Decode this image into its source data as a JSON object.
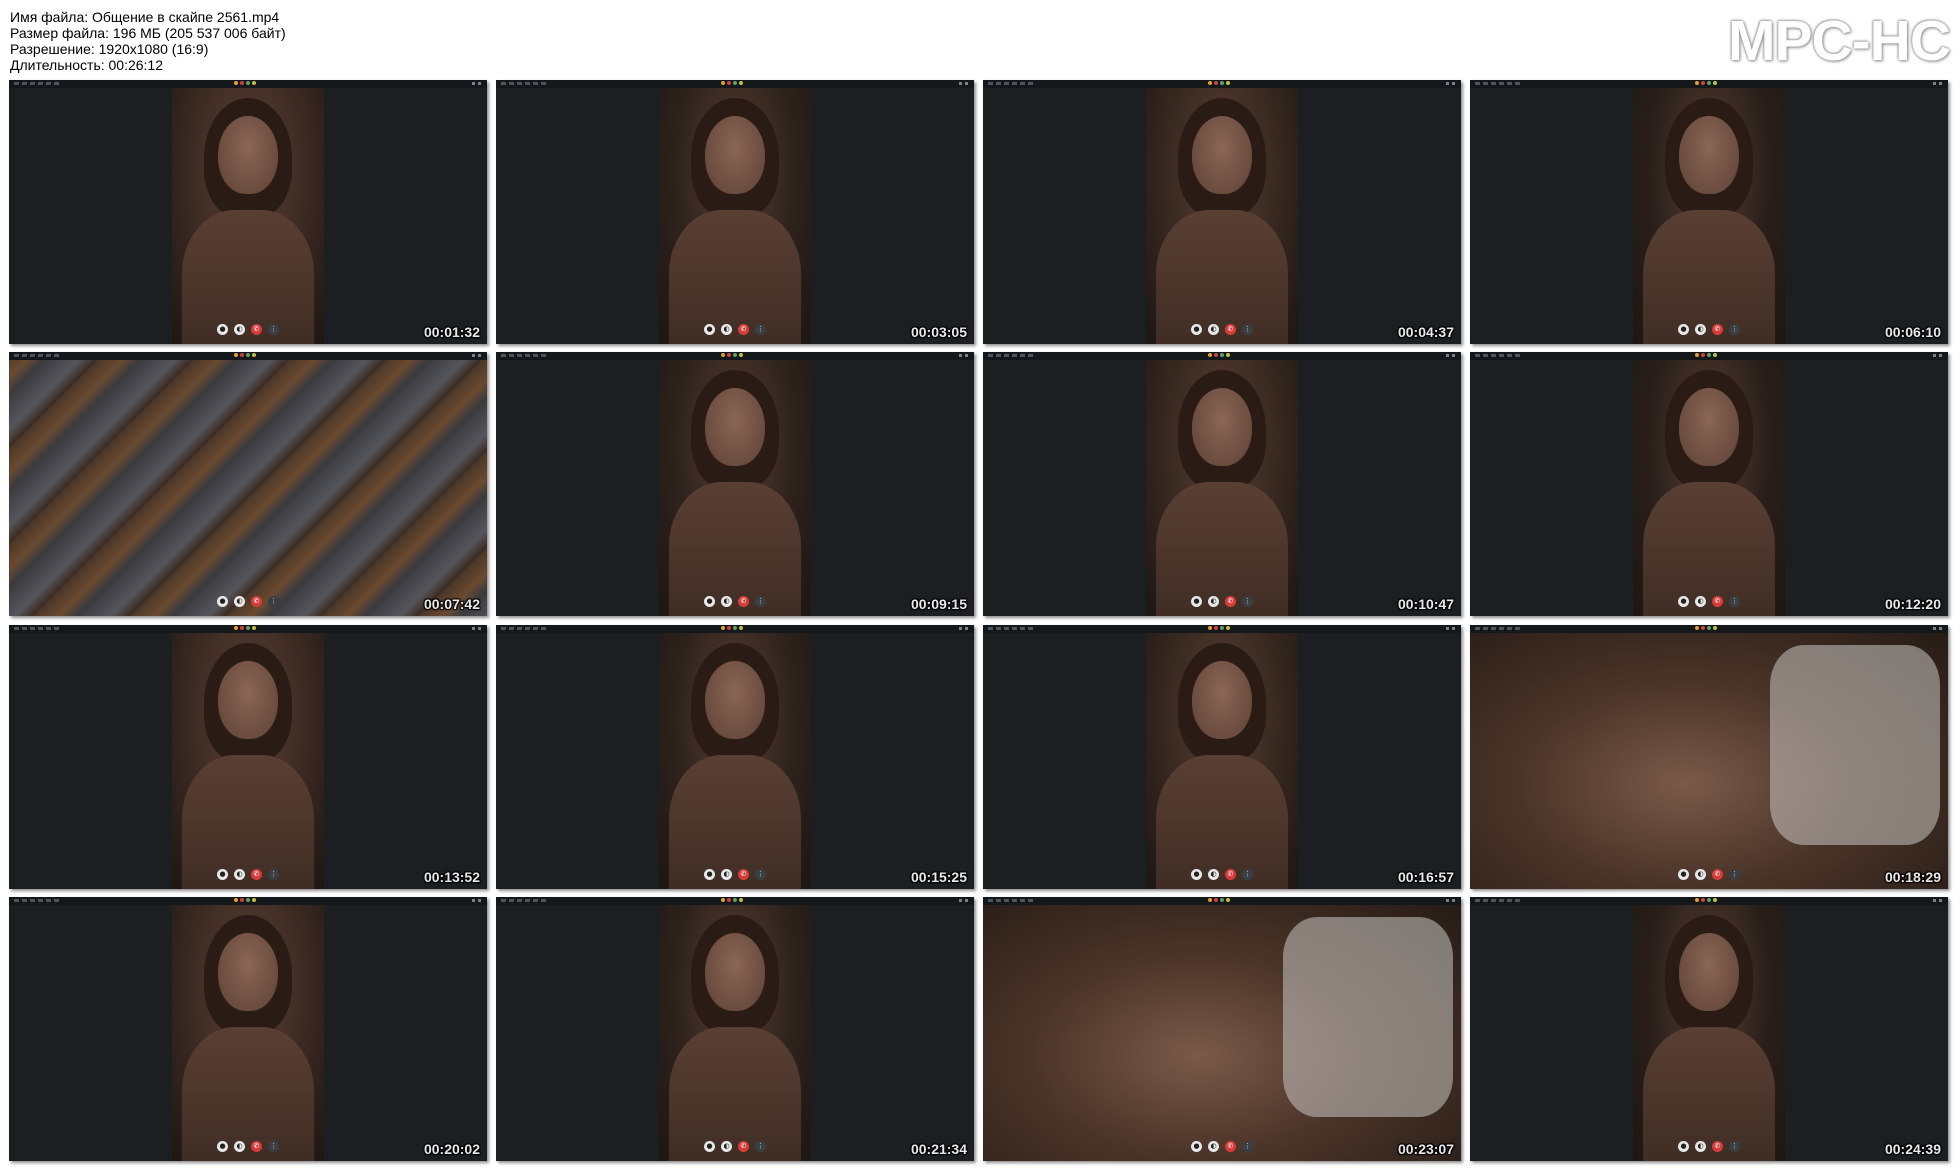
{
  "info": {
    "file_name": "Имя файла: Общение в скайпе 2561.mp4",
    "file_size": "Размер файла: 196 МБ (205 537 006 байт)",
    "resolution": "Разрешение: 1920x1080 (16:9)",
    "duration": "Длительность: 00:26:12"
  },
  "logo": "MPC-HC",
  "thumbnails": [
    {
      "time": "00:01:32",
      "scene": "portrait"
    },
    {
      "time": "00:03:05",
      "scene": "portrait"
    },
    {
      "time": "00:04:37",
      "scene": "portrait"
    },
    {
      "time": "00:06:10",
      "scene": "portrait"
    },
    {
      "time": "00:07:42",
      "scene": "ceiling"
    },
    {
      "time": "00:09:15",
      "scene": "portrait"
    },
    {
      "time": "00:10:47",
      "scene": "portrait"
    },
    {
      "time": "00:12:20",
      "scene": "portrait"
    },
    {
      "time": "00:13:52",
      "scene": "portrait"
    },
    {
      "time": "00:15:25",
      "scene": "portrait"
    },
    {
      "time": "00:16:57",
      "scene": "portrait"
    },
    {
      "time": "00:18:29",
      "scene": "landscape"
    },
    {
      "time": "00:20:02",
      "scene": "portrait"
    },
    {
      "time": "00:21:34",
      "scene": "portrait"
    },
    {
      "time": "00:23:07",
      "scene": "landscape"
    },
    {
      "time": "00:24:39",
      "scene": "portrait"
    }
  ],
  "colors": {
    "page_bg": "#ffffff",
    "thumb_bg": "#1b1f22",
    "call_end": "#d93a3a",
    "timestamp": "#e8e8e8"
  }
}
